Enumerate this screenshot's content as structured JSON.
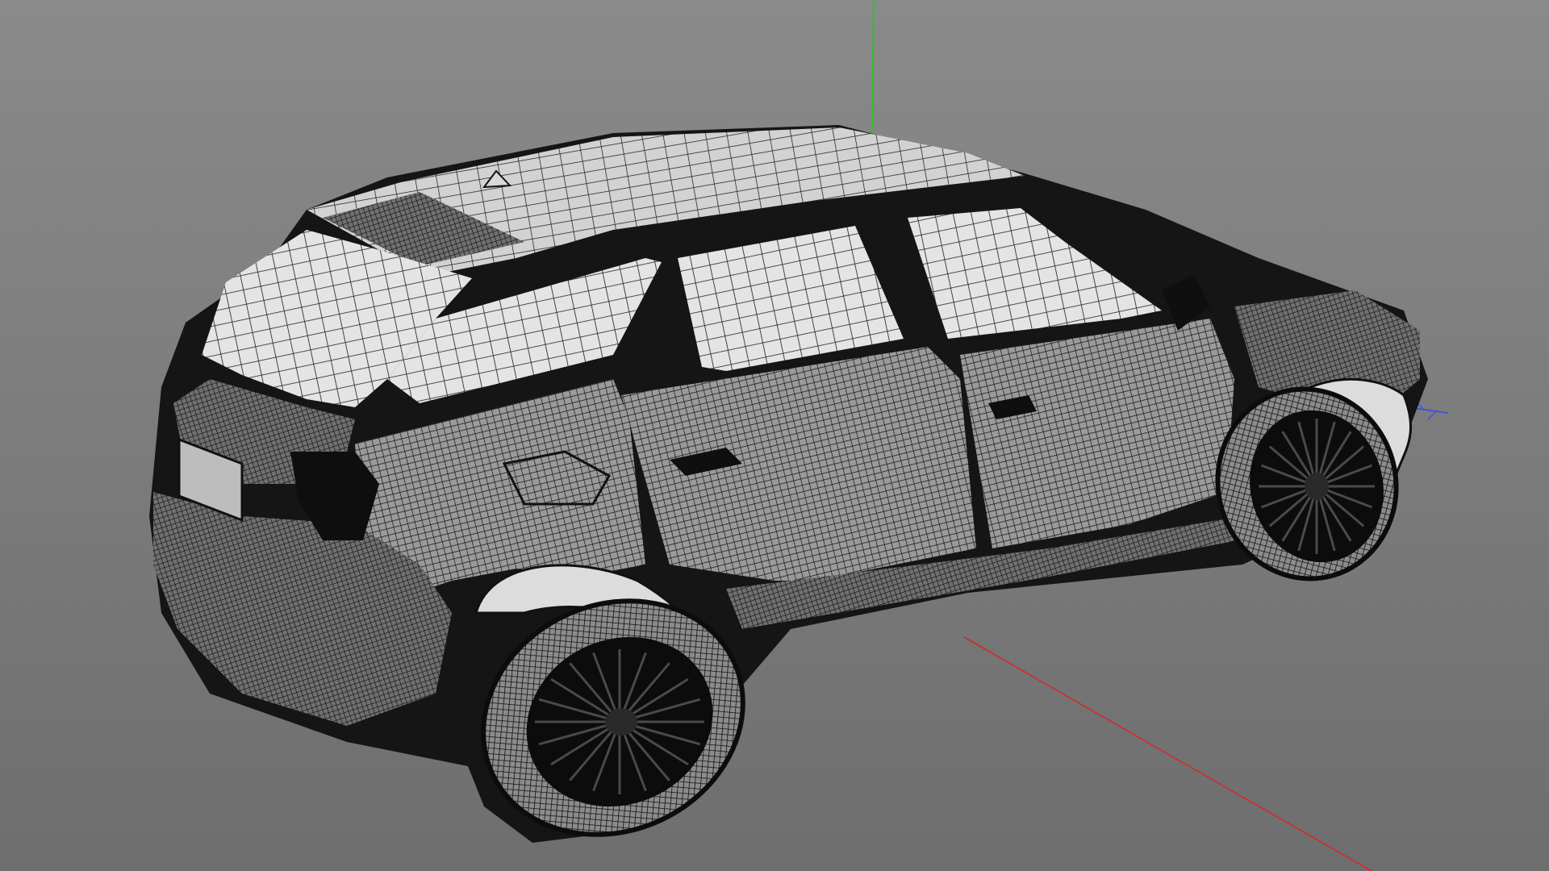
{
  "viewport": {
    "background_top": "#8a8a8a",
    "background_bottom": "#6e6e6e",
    "mesh_color": "#1b1b1b",
    "panel_color": "#e2e2e2",
    "axis_x_color": "#d42a2a",
    "axis_y_color": "#2fbf2f",
    "axis_z_color": "#3f4fe0"
  },
  "model": {
    "display_mode": "wireframe"
  }
}
